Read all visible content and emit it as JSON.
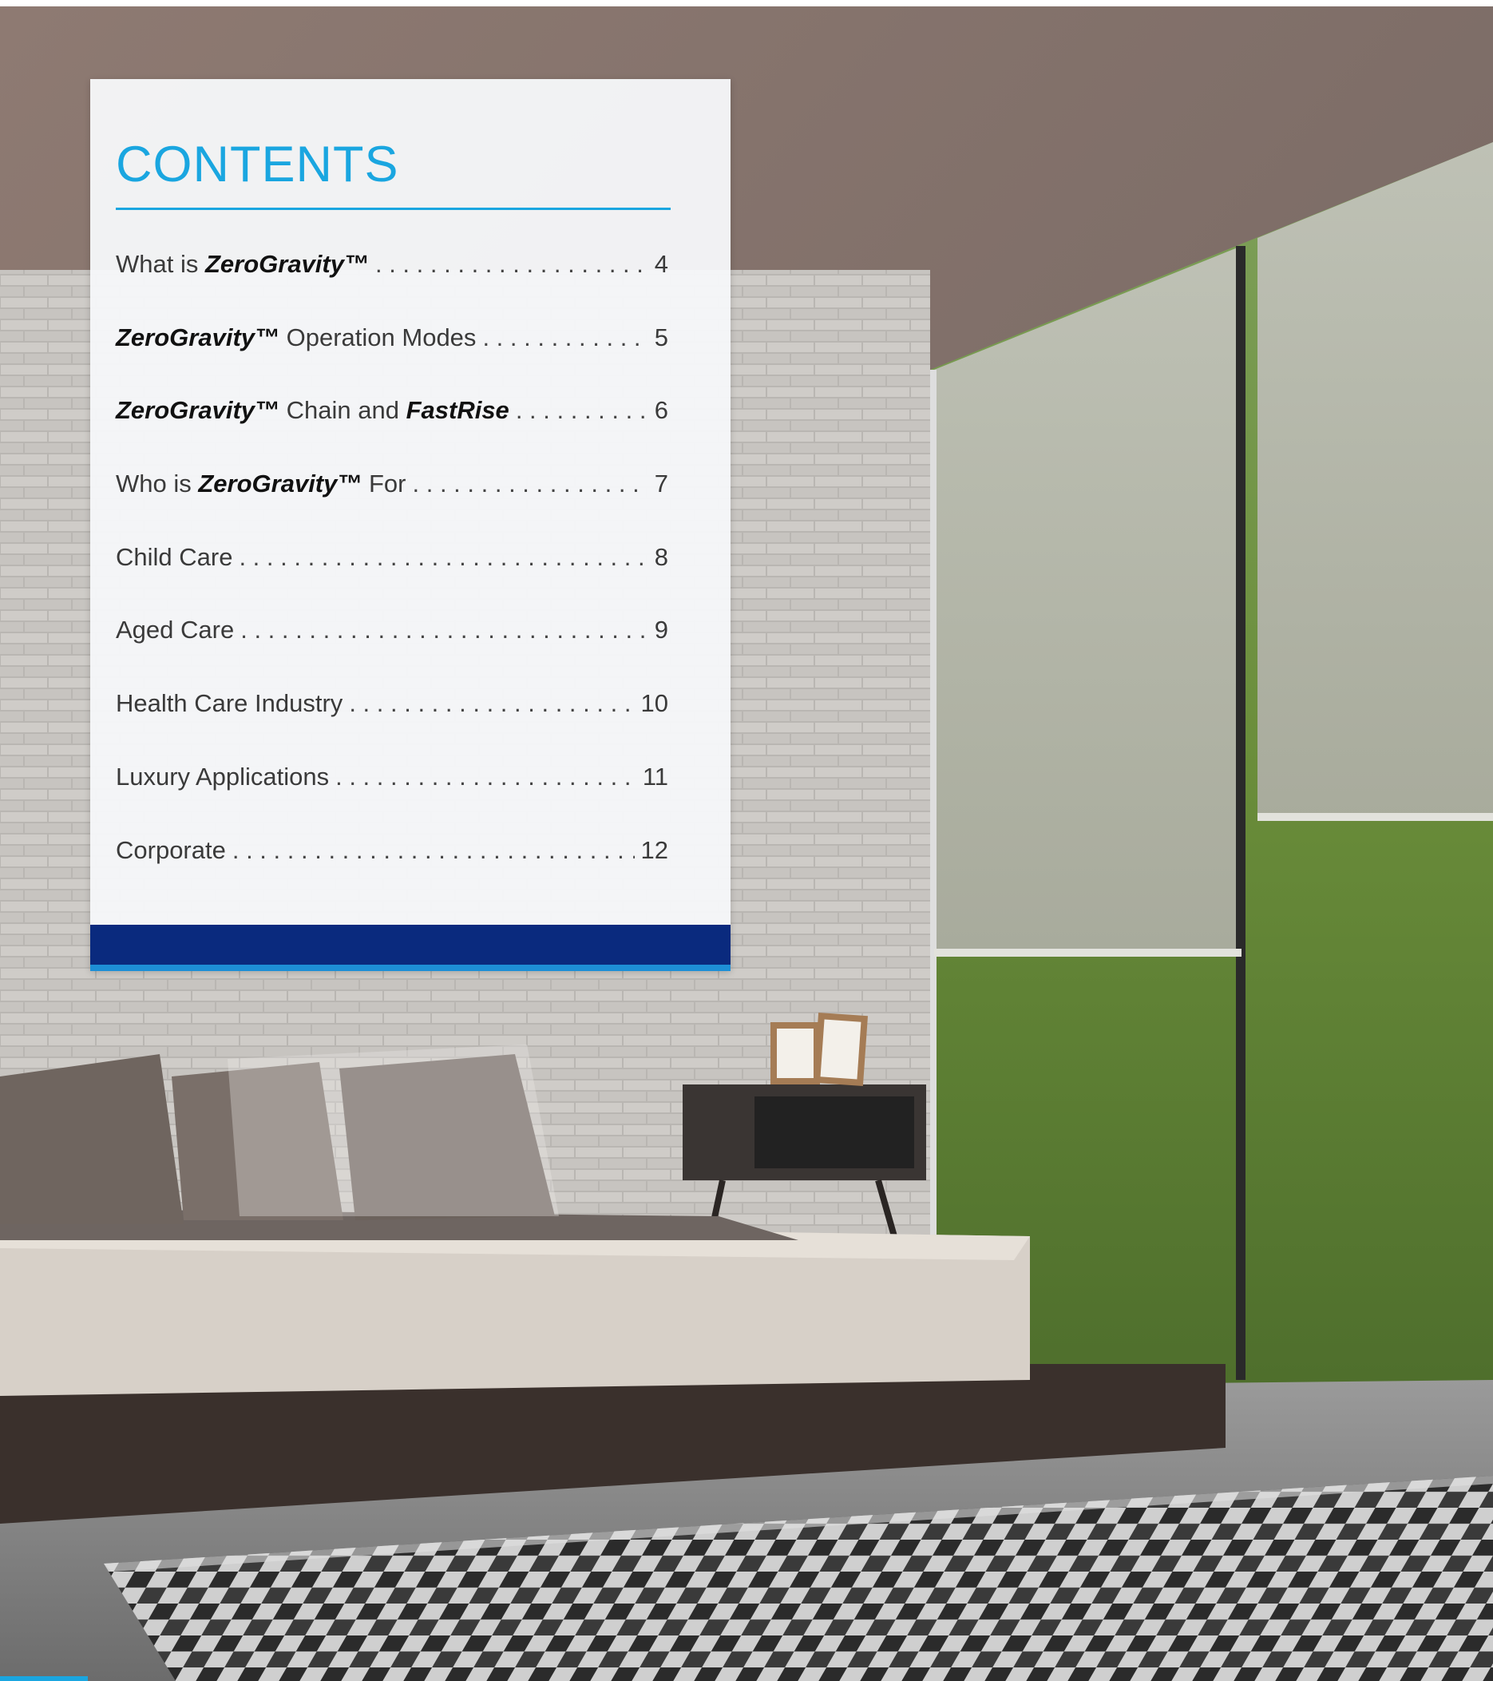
{
  "contents": {
    "title": "CONTENTS",
    "entries": [
      {
        "prefix": "What is ",
        "bold": "ZeroGravity™",
        "suffix": "",
        "bold2": "",
        "page": "4"
      },
      {
        "prefix": "",
        "bold": "ZeroGravity™",
        "suffix": " Operation Modes",
        "bold2": "",
        "page": "5"
      },
      {
        "prefix": "",
        "bold": "ZeroGravity™",
        "suffix": " Chain and ",
        "bold2": "FastRise",
        "page": "6"
      },
      {
        "prefix": "Who is ",
        "bold": "ZeroGravity™",
        "suffix": " For",
        "bold2": "",
        "page": "7"
      },
      {
        "prefix": "Child Care",
        "bold": "",
        "suffix": "",
        "bold2": "",
        "page": "8"
      },
      {
        "prefix": "Aged Care",
        "bold": "",
        "suffix": "",
        "bold2": "",
        "page": "9"
      },
      {
        "prefix": "Health Care Industry",
        "bold": "",
        "suffix": "",
        "bold2": "",
        "page": "10"
      },
      {
        "prefix": "Luxury Applications",
        "bold": "",
        "suffix": "",
        "bold2": "",
        "page": "11"
      },
      {
        "prefix": "Corporate",
        "bold": "",
        "suffix": "",
        "bold2": "",
        "page": "12"
      }
    ]
  },
  "colors": {
    "accent": "#1aa6e0",
    "navy_band": "#0a2a7e",
    "blue_band": "#1d8fd6"
  }
}
